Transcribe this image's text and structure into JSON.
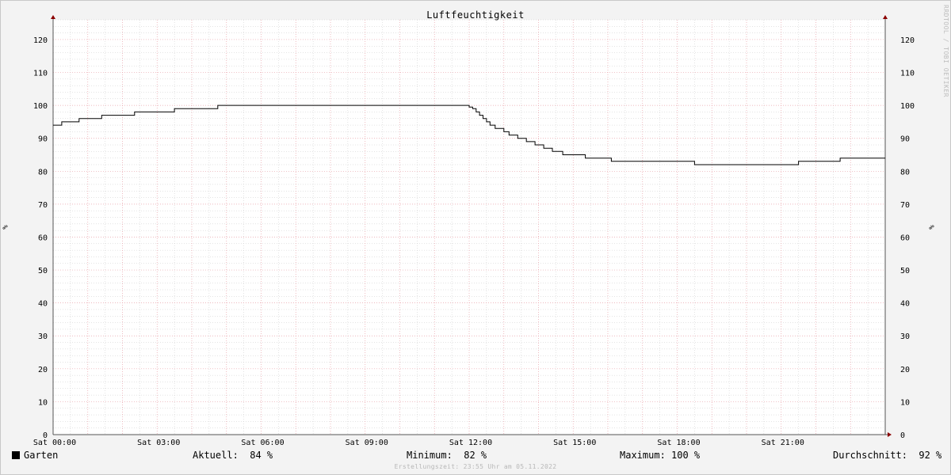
{
  "chart_data": {
    "type": "line",
    "title": "Luftfeuchtigkeit",
    "watermark": "RRDTOOL / TOBI OETIKER",
    "ylabel": "%",
    "ylim": [
      0,
      126
    ],
    "yticks": [
      0,
      10,
      20,
      30,
      40,
      50,
      60,
      70,
      80,
      90,
      100,
      110,
      120
    ],
    "xlim": [
      0,
      24
    ],
    "xticks": [
      {
        "hour": 0,
        "label": "Sat 00:00"
      },
      {
        "hour": 3,
        "label": "Sat 03:00"
      },
      {
        "hour": 6,
        "label": "Sat 06:00"
      },
      {
        "hour": 9,
        "label": "Sat 09:00"
      },
      {
        "hour": 12,
        "label": "Sat 12:00"
      },
      {
        "hour": 15,
        "label": "Sat 15:00"
      },
      {
        "hour": 18,
        "label": "Sat 18:00"
      },
      {
        "hour": 21,
        "label": "Sat 21:00"
      }
    ],
    "grid": true,
    "legend_position": "bottom",
    "colors": {
      "line": "#000000",
      "major_grid": "#e8a0a8",
      "minor_grid": "#c8c8c8"
    },
    "series": [
      {
        "name": "Garten",
        "step": true,
        "points": [
          [
            0.0,
            94
          ],
          [
            0.25,
            95
          ],
          [
            0.75,
            96
          ],
          [
            1.4,
            97
          ],
          [
            2.35,
            98
          ],
          [
            3.5,
            99
          ],
          [
            4.75,
            100
          ],
          [
            12.0,
            99.5
          ],
          [
            12.1,
            99
          ],
          [
            12.2,
            98
          ],
          [
            12.3,
            97
          ],
          [
            12.4,
            96
          ],
          [
            12.5,
            95
          ],
          [
            12.6,
            94
          ],
          [
            12.75,
            93
          ],
          [
            13.0,
            92
          ],
          [
            13.15,
            91
          ],
          [
            13.4,
            90
          ],
          [
            13.65,
            89
          ],
          [
            13.9,
            88
          ],
          [
            14.15,
            87
          ],
          [
            14.4,
            86
          ],
          [
            14.7,
            85
          ],
          [
            15.35,
            84
          ],
          [
            16.1,
            83
          ],
          [
            18.5,
            82
          ],
          [
            21.5,
            83
          ],
          [
            22.7,
            84
          ],
          [
            24.0,
            84
          ]
        ]
      }
    ]
  },
  "legend": {
    "series_name": "Garten",
    "current": "Aktuell:  84 %",
    "minimum": "Minimum:  82 %",
    "maximum": "Maximum: 100 %",
    "average": "Durchschnitt:  92 %"
  },
  "footer": "Erstellungszeit: 23:55 Uhr am 05.11.2022"
}
